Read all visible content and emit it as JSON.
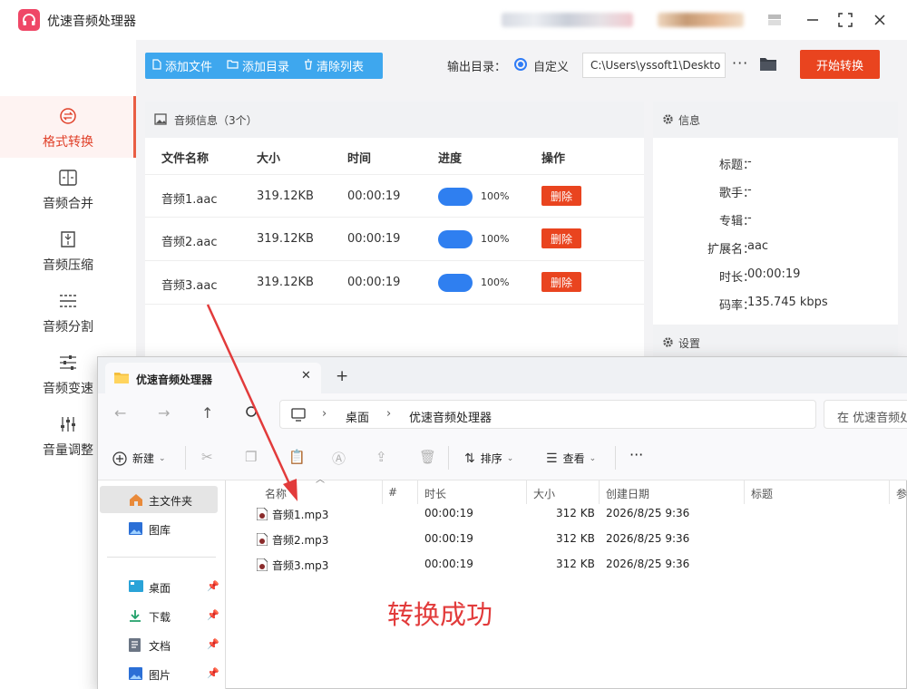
{
  "app": {
    "title": "优速音频处理器",
    "toolbar": {
      "add_file": "添加文件",
      "add_dir": "添加目录",
      "clear_list": "清除列表"
    },
    "output_label": "输出目录：",
    "output_option": "自定义",
    "output_path": "C:\\Users\\yssoft1\\Deskto",
    "more": "···",
    "start_button": "开始转换",
    "sidebar": [
      {
        "label": "格式转换",
        "icon": "format-convert-icon"
      },
      {
        "label": "音频合并",
        "icon": "merge-icon"
      },
      {
        "label": "音频压缩",
        "icon": "compress-icon"
      },
      {
        "label": "音频分割",
        "icon": "split-icon"
      },
      {
        "label": "音频变速",
        "icon": "speed-icon"
      },
      {
        "label": "音量调整",
        "icon": "volume-icon"
      }
    ],
    "list": {
      "header": "音频信息（3个）",
      "columns": [
        "文件名称",
        "大小",
        "时间",
        "进度",
        "操作"
      ],
      "rows": [
        {
          "name": "音频1.aac",
          "size": "319.12KB",
          "time": "00:00:19",
          "progress_text": "100%",
          "progress": 1.0,
          "action": "删除"
        },
        {
          "name": "音频2.aac",
          "size": "319.12KB",
          "time": "00:00:19",
          "progress_text": "100%",
          "progress": 1.0,
          "action": "删除"
        },
        {
          "name": "音频3.aac",
          "size": "319.12KB",
          "time": "00:00:19",
          "progress_text": "100%",
          "progress": 1.0,
          "action": "删除"
        }
      ]
    },
    "info": {
      "header": "信息",
      "fields": [
        {
          "key": "标题：",
          "value": "-"
        },
        {
          "key": "歌手：",
          "value": "-"
        },
        {
          "key": "专辑：",
          "value": "-"
        },
        {
          "key": "扩展名：",
          "value": "aac"
        },
        {
          "key": "时长：",
          "value": "00:00:19"
        },
        {
          "key": "码率：",
          "value": "135.745 kbps"
        }
      ]
    },
    "settings_header": "设置"
  },
  "explorer": {
    "tab_title": "优速音频处理器",
    "tab_close": "✕",
    "tab_new": "+",
    "breadcrumb": [
      "桌面",
      "优速音频处理器"
    ],
    "search_placeholder": "在 优速音频处理器",
    "commands": {
      "new": "新建",
      "sort": "排序",
      "view": "查看",
      "more": "···"
    },
    "nav": [
      {
        "label": "主文件夹",
        "icon": "home-icon",
        "selected": true
      },
      {
        "label": "图库",
        "icon": "gallery-icon"
      },
      {
        "label": "桌面",
        "icon": "desktop-icon",
        "pinned": true
      },
      {
        "label": "下载",
        "icon": "download-icon",
        "pinned": true
      },
      {
        "label": "文档",
        "icon": "document-icon",
        "pinned": true
      },
      {
        "label": "图片",
        "icon": "pictures-icon",
        "pinned": true
      }
    ],
    "columns": [
      "名称",
      "#",
      "时长",
      "大小",
      "创建日期",
      "标题",
      "参"
    ],
    "files": [
      {
        "name": "音频1.mp3",
        "duration": "00:00:19",
        "size": "312 KB",
        "created": "2026/8/25 9:36"
      },
      {
        "name": "音频2.mp3",
        "duration": "00:00:19",
        "size": "312 KB",
        "created": "2026/8/25 9:36"
      },
      {
        "name": "音频3.mp3",
        "duration": "00:00:19",
        "size": "312 KB",
        "created": "2026/8/25 9:36"
      }
    ]
  },
  "annotation": "转换成功",
  "colors": {
    "accent_red": "#e9441f",
    "toolbar_blue": "#3ea7ee",
    "toggle_blue": "#2f7ff0",
    "annotation_red": "#e23b3b",
    "logo_pink": "#ef4767"
  }
}
